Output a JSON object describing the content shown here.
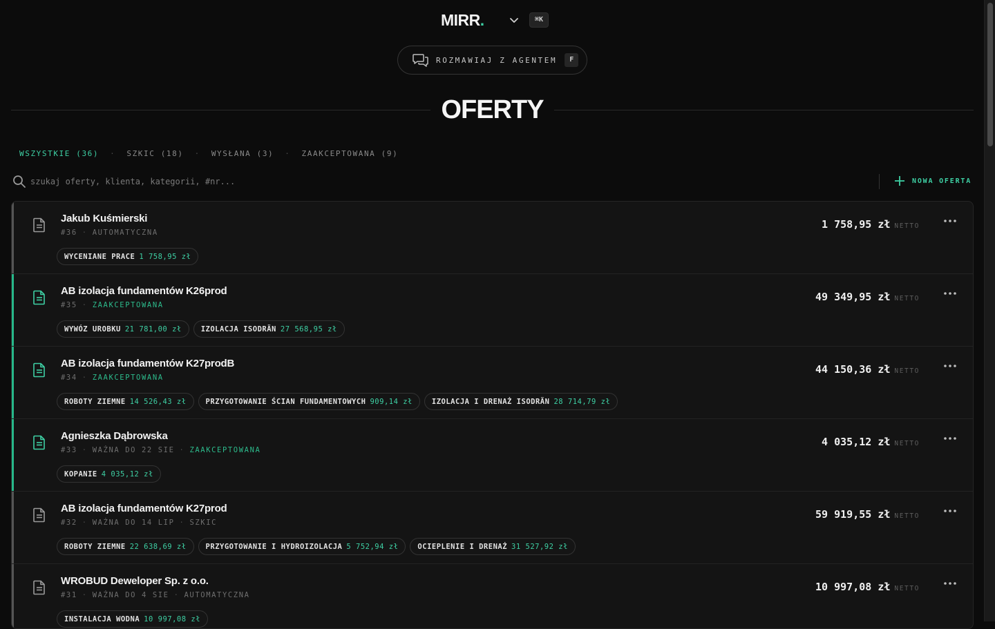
{
  "header": {
    "logo_text": "MIRR",
    "logo_dot": ".",
    "shortcut": "⌘K"
  },
  "agent_button": {
    "label": "ROZMAWIAJ Z AGENTEM",
    "shortcut": "F"
  },
  "page": {
    "title": "OFERTY"
  },
  "tabs": [
    {
      "label": "WSZYSTKIE (36)",
      "active": true
    },
    {
      "label": "SZKIC (18)",
      "active": false
    },
    {
      "label": "WYSŁANA (3)",
      "active": false
    },
    {
      "label": "ZAAKCEPTOWANA (9)",
      "active": false
    }
  ],
  "tab_separator": "·",
  "search": {
    "placeholder": "szukaj oferty, klienta, kategorii, #nr..."
  },
  "new_offer_label": "NOWA OFERTA",
  "offers": [
    {
      "name": "Jakub Kuśmierski",
      "meta": [
        {
          "text": "#36"
        },
        {
          "text": "AUTOMATYCZNA"
        }
      ],
      "amount": "1 758,95 zł",
      "amount_suffix": "NETTO",
      "accepted": false,
      "chips": [
        {
          "label": "WYCENIANE PRACE",
          "value": "1 758,95 zł"
        }
      ]
    },
    {
      "name": "AB izolacja fundamentów K26prod",
      "meta": [
        {
          "text": "#35"
        },
        {
          "text": "ZAAKCEPTOWANA",
          "status": "accepted"
        }
      ],
      "amount": "49 349,95 zł",
      "amount_suffix": "NETTO",
      "accepted": true,
      "chips": [
        {
          "label": "WYWÓZ UROBKU",
          "value": "21 781,00 zł"
        },
        {
          "label": "IZOLACJA ISODRÄN",
          "value": "27 568,95 zł"
        }
      ]
    },
    {
      "name": "AB izolacja fundamentów K27prodB",
      "meta": [
        {
          "text": "#34"
        },
        {
          "text": "ZAAKCEPTOWANA",
          "status": "accepted"
        }
      ],
      "amount": "44 150,36 zł",
      "amount_suffix": "NETTO",
      "accepted": true,
      "chips": [
        {
          "label": "ROBOTY ZIEMNE",
          "value": "14 526,43 zł"
        },
        {
          "label": "PRZYGOTOWANIE ŚCIAN FUNDAMENTOWYCH",
          "value": "909,14 zł"
        },
        {
          "label": "IZOLACJA I DRENAŻ ISODRÄN",
          "value": "28 714,79 zł"
        }
      ]
    },
    {
      "name": "Agnieszka Dąbrowska",
      "meta": [
        {
          "text": "#33"
        },
        {
          "text": "WAŻNA DO 22 SIE"
        },
        {
          "text": "ZAAKCEPTOWANA",
          "status": "accepted"
        }
      ],
      "amount": "4 035,12 zł",
      "amount_suffix": "NETTO",
      "accepted": true,
      "chips": [
        {
          "label": "KOPANIE",
          "value": "4 035,12 zł"
        }
      ]
    },
    {
      "name": "AB izolacja fundamentów K27prod",
      "meta": [
        {
          "text": "#32"
        },
        {
          "text": "WAŻNA DO 14 LIP"
        },
        {
          "text": "SZKIC"
        }
      ],
      "amount": "59 919,55 zł",
      "amount_suffix": "NETTO",
      "accepted": false,
      "chips": [
        {
          "label": "ROBOTY ZIEMNE",
          "value": "22 638,69 zł"
        },
        {
          "label": "PRZYGOTOWANIE I HYDROIZOLACJA",
          "value": "5 752,94 zł"
        },
        {
          "label": "OCIEPLENIE I DRENAŻ",
          "value": "31 527,92 zł"
        }
      ]
    },
    {
      "name": "WROBUD Deweloper Sp. z o.o.",
      "meta": [
        {
          "text": "#31"
        },
        {
          "text": "WAŻNA DO 4 SIE"
        },
        {
          "text": "AUTOMATYCZNA"
        }
      ],
      "amount": "10 997,08 zł",
      "amount_suffix": "NETTO",
      "accepted": false,
      "chips": [
        {
          "label": "INSTALACJA WODNA",
          "value": "10 997,08 zł"
        }
      ]
    }
  ],
  "colors": {
    "accent": "#3ed0a4",
    "accepted_bar": "#27b88a",
    "default_bar": "#555555",
    "background": "#0c0c0c"
  }
}
